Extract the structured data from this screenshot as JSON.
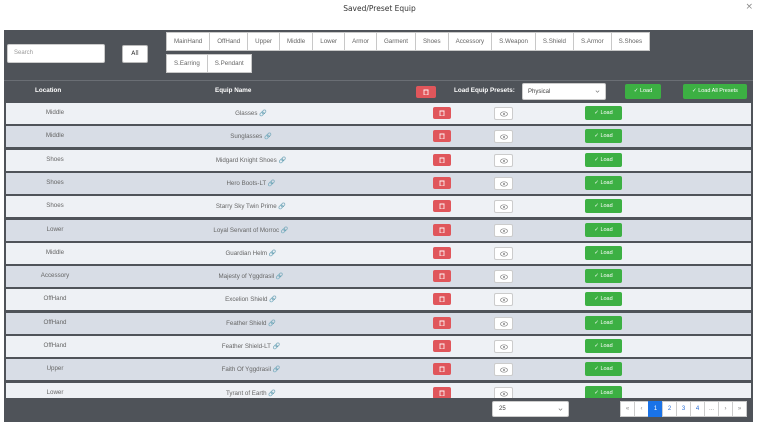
{
  "window": {
    "title": "Saved/Preset Equip",
    "close_glyph": "×"
  },
  "filters": {
    "search_placeholder": "Search",
    "all_label": "All",
    "tabs_row1": [
      "MainHand",
      "OffHand",
      "Upper",
      "Middle",
      "Lower",
      "Armor",
      "Garment",
      "Shoes",
      "Accessory",
      "S.Weapon",
      "S.Shield",
      "S.Armor",
      "S.Shoes"
    ],
    "tabs_row2": [
      "S.Earring",
      "S.Pendant"
    ]
  },
  "table": {
    "col_location": "Location",
    "col_equip_name": "Equip Name",
    "preset_label": "Load Equip Presets:",
    "preset_selected": "Physical",
    "load_label": "Load",
    "load_all_label": "Load All Presets",
    "rows": [
      {
        "location": "Middle",
        "name": "Glasses"
      },
      {
        "location": "Middle",
        "name": "Sunglasses"
      },
      {
        "location": "Shoes",
        "name": "Midgard Knight Shoes"
      },
      {
        "location": "Shoes",
        "name": "Hero Boots-LT"
      },
      {
        "location": "Shoes",
        "name": "Starry Sky Twin Prime"
      },
      {
        "location": "Lower",
        "name": "Loyal Servant of Morroc"
      },
      {
        "location": "Middle",
        "name": "Guardian Helm"
      },
      {
        "location": "Accessory",
        "name": "Majesty of Yggdrasil"
      },
      {
        "location": "OffHand",
        "name": "Excelion Shield"
      },
      {
        "location": "OffHand",
        "name": "Feather Shield"
      },
      {
        "location": "OffHand",
        "name": "Feather Shield-LT"
      },
      {
        "location": "Upper",
        "name": "Faith Of Yggdrasil"
      },
      {
        "location": "Lower",
        "name": "Tyrant of Earth"
      }
    ]
  },
  "footer": {
    "page_size": "25",
    "pages": [
      "«",
      "‹",
      "1",
      "2",
      "3",
      "4",
      "...",
      "›",
      "»"
    ],
    "active_page": "1"
  },
  "colors": {
    "panel": "#4f5359",
    "danger": "#e0565b",
    "success": "#3cb043",
    "primary": "#1a73e8"
  },
  "icons": {
    "delete": "trash-icon",
    "view": "eye-icon",
    "load": "check-icon",
    "link": "link-icon",
    "dropdown": "chevron-down-icon"
  }
}
